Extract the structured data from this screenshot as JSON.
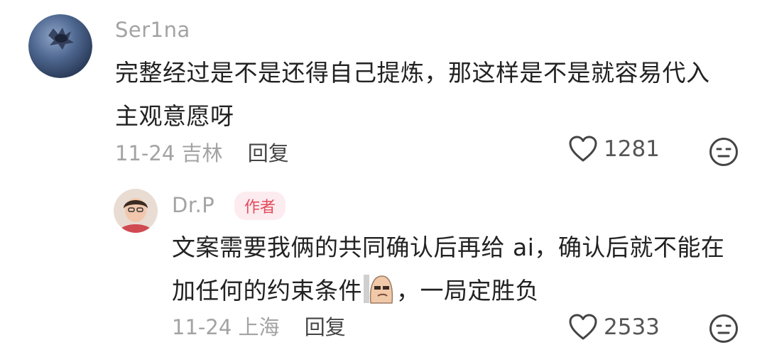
{
  "comments": [
    {
      "username": "Ser1na",
      "text_line1": "完整经过是不是还得自己提炼，那这样是不是就容易代入",
      "text_line2": "主观意愿呀",
      "date": "11-24",
      "location": "吉林",
      "reply_label": "回复",
      "likes": "1281"
    },
    {
      "username": "Dr.P",
      "author_tag": "作者",
      "text_line1": "文案需要我俩的共同确认后再给 ai，确认后就不能在",
      "text_line2_before": "加任何的约束条件",
      "text_line2_after": "，一局定胜负",
      "date": "11-24",
      "location": "上海",
      "reply_label": "回复",
      "likes": "2533"
    }
  ],
  "icons": [
    "blueberry-avatar",
    "user-photo-avatar",
    "heart-icon",
    "dislike-face-icon",
    "sticker-emoji"
  ]
}
